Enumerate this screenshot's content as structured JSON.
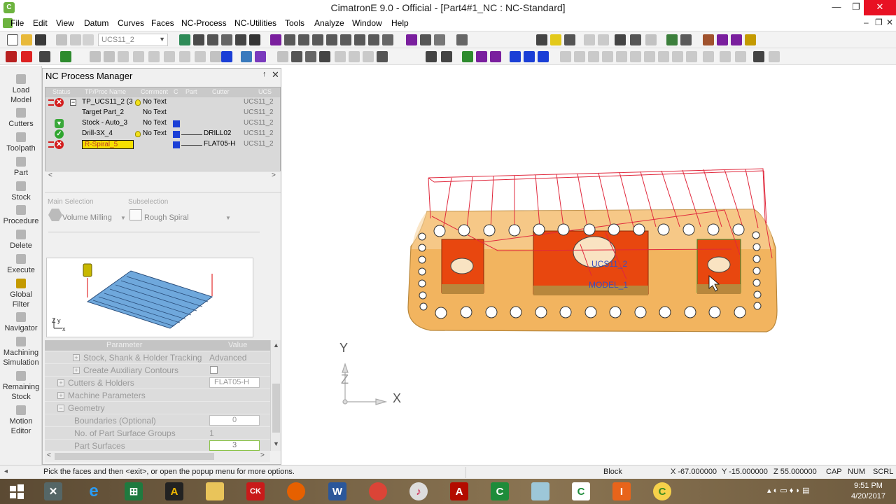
{
  "window": {
    "title": "CimatronE 9.0 - Official - [Part4#1_NC : NC-Standard]",
    "min": "—",
    "restore": "❐",
    "close": "✕"
  },
  "menu": [
    "File",
    "Edit",
    "View",
    "Datum",
    "Curves",
    "Faces",
    "NC-Process",
    "NC-Utilities",
    "Tools",
    "Analyze",
    "Window",
    "Help"
  ],
  "mdi_controls": [
    "–",
    "❐",
    "✕"
  ],
  "toolbar": {
    "ucs_value": "UCS11_2"
  },
  "rail": [
    {
      "line1": "Load",
      "line2": "Model",
      "icon": "load-model-icon"
    },
    {
      "line1": "Cutters",
      "line2": "",
      "icon": "cutters-icon"
    },
    {
      "line1": "Toolpath",
      "line2": "",
      "icon": "toolpath-icon"
    },
    {
      "line1": "Part",
      "line2": "",
      "icon": "part-icon"
    },
    {
      "line1": "Stock",
      "line2": "",
      "icon": "stock-icon"
    },
    {
      "line1": "Procedure",
      "line2": "",
      "icon": "procedure-icon"
    },
    {
      "line1": "Delete",
      "line2": "",
      "icon": "delete-icon"
    },
    {
      "line1": "Execute",
      "line2": "",
      "icon": "execute-icon"
    },
    {
      "line1": "Global",
      "line2": "Filter",
      "icon": "global-filter-icon"
    },
    {
      "line1": "Navigator",
      "line2": "",
      "icon": "navigator-icon"
    },
    {
      "line1": "Machining",
      "line2": "Simulation",
      "icon": "machining-simulation-icon"
    },
    {
      "line1": "Remaining",
      "line2": "Stock",
      "icon": "remaining-stock-icon"
    },
    {
      "line1": "Motion",
      "line2": "Editor",
      "icon": "motion-editor-icon"
    }
  ],
  "nc_panel": {
    "title": "NC Process Manager",
    "pin": "↑",
    "close": "✕",
    "columns": [
      "Status",
      "TP/Proc Name",
      "Comment",
      "C",
      "Part",
      "Cutter",
      "UCS"
    ],
    "rows": [
      {
        "status": "error",
        "name": "TP_UCS11_2 (3",
        "comment": "No Text",
        "bulb": true,
        "blue": false,
        "cutter": "",
        "ucs": "UCS11_2",
        "expander": "−"
      },
      {
        "status": "none",
        "name": "Target Part_2",
        "comment": "No Text",
        "bulb": false,
        "blue": false,
        "cutter": "",
        "ucs": "UCS11_2",
        "expander": ""
      },
      {
        "status": "down",
        "name": "Stock - Auto_3",
        "comment": "No Text",
        "bulb": false,
        "blue": true,
        "cutter": "",
        "ucs": "UCS11_2",
        "expander": ""
      },
      {
        "status": "ok",
        "name": "Drill-3X_4",
        "comment": "No Text",
        "bulb": true,
        "blue": true,
        "cutter": "DRILL02",
        "ucs": "UCS11_2",
        "expander": ""
      },
      {
        "status": "error",
        "name": "R-Spiral_5",
        "comment": "",
        "bulb": false,
        "blue": true,
        "cutter": "FLAT05-H",
        "ucs": "UCS11_2",
        "expander": "",
        "selected": true
      }
    ],
    "scroll_left": "<",
    "scroll_right": ">",
    "main_selection_label": "Main Selection",
    "main_selection_value": "Volume Milling",
    "subselection_label": "Subselection",
    "subselection_value": "Rough Spiral",
    "preview_axes": "Z y",
    "preview_axes_x": "x",
    "params_header": [
      "Parameter",
      "Value"
    ],
    "params": [
      {
        "name": "Stock, Shank & Holder Tracking",
        "value": "Advanced",
        "kind": "text",
        "indent": 1,
        "exp": "+"
      },
      {
        "name": "Create Auxiliary Contours",
        "value": "",
        "kind": "checkbox",
        "indent": 1,
        "exp": "+"
      },
      {
        "name": "Cutters & Holders",
        "value": "FLAT05-H",
        "kind": "box",
        "indent": 0,
        "exp": "+"
      },
      {
        "name": "Machine Parameters",
        "value": "",
        "kind": "text",
        "indent": 0,
        "exp": "+"
      },
      {
        "name": "Geometry",
        "value": "",
        "kind": "text",
        "indent": 0,
        "exp": "−"
      },
      {
        "name": "Boundaries (Optional)",
        "value": "0",
        "kind": "box",
        "indent": 2,
        "exp": ""
      },
      {
        "name": "No. of Part Surface Groups",
        "value": "1",
        "kind": "text",
        "indent": 2,
        "exp": ""
      },
      {
        "name": "Part Surfaces",
        "value": "3",
        "kind": "boxg",
        "indent": 2,
        "exp": ""
      }
    ],
    "scroll_up": "▲",
    "scroll_down": "▼"
  },
  "viewport": {
    "axis_y": "Y",
    "axis_x": "X",
    "axis_z": "Z",
    "ucs_label": "UCS11_2",
    "model_label": "MODEL_1"
  },
  "status": {
    "prompt": "Pick the faces and then <exit>, or open the popup menu for more options.",
    "mode": "Block",
    "x": "X -67.000000",
    "y": "Y -15.000000",
    "z": "Z 55.000000",
    "caps": "CAP",
    "num": "NUM",
    "scrl": "SCRL"
  },
  "taskbar": {
    "time": "9:51 PM",
    "date": "4/20/2017"
  },
  "colors": {
    "part_face": "#f7c78a",
    "pocket": "#e8470f",
    "toolpath": "#e0283c",
    "accent_blue": "#1b3fd6"
  }
}
